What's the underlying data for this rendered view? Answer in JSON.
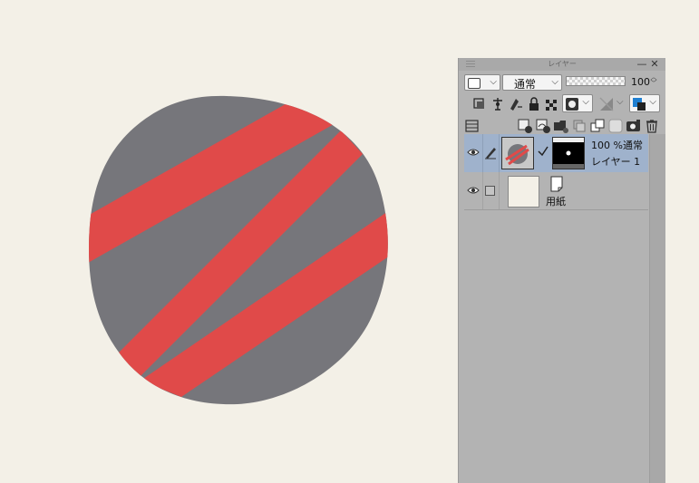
{
  "colors": {
    "canvas_bg": "#f3f0e7",
    "ball_gray": "#76767b",
    "stripe_red": "#e04a49",
    "panel_bg": "#b3b3b3",
    "selected_row": "#9fb2cc"
  },
  "canvas": {
    "content": "gray ball with three red diagonal stripes"
  },
  "panel": {
    "title": "レイヤー",
    "minimize_glyph": "—",
    "close_glyph": "✕",
    "blend_mode": "通常",
    "opacity_value": "100",
    "toolbar_icons": [
      "clip-to-layer-below-icon",
      "reference-layer-icon",
      "draft-layer-icon",
      "lock-layer-icon",
      "lock-transparency-icon",
      "mask-layer-icon",
      "layer-color-icon",
      "palette-color-icon"
    ],
    "action_icons": [
      "layer-property-icon",
      "new-raster-layer-icon",
      "new-vector-layer-icon",
      "new-folder-icon",
      "transfer-down-icon",
      "merge-down-icon",
      "layer-mask-icon",
      "apply-mask-icon",
      "delete-layer-icon"
    ]
  },
  "layers": [
    {
      "opacity_blend": "100 %通常",
      "name": "レイヤー 1",
      "visible": true,
      "selected": true
    },
    {
      "name": "用紙",
      "visible": true,
      "selected": false
    }
  ]
}
